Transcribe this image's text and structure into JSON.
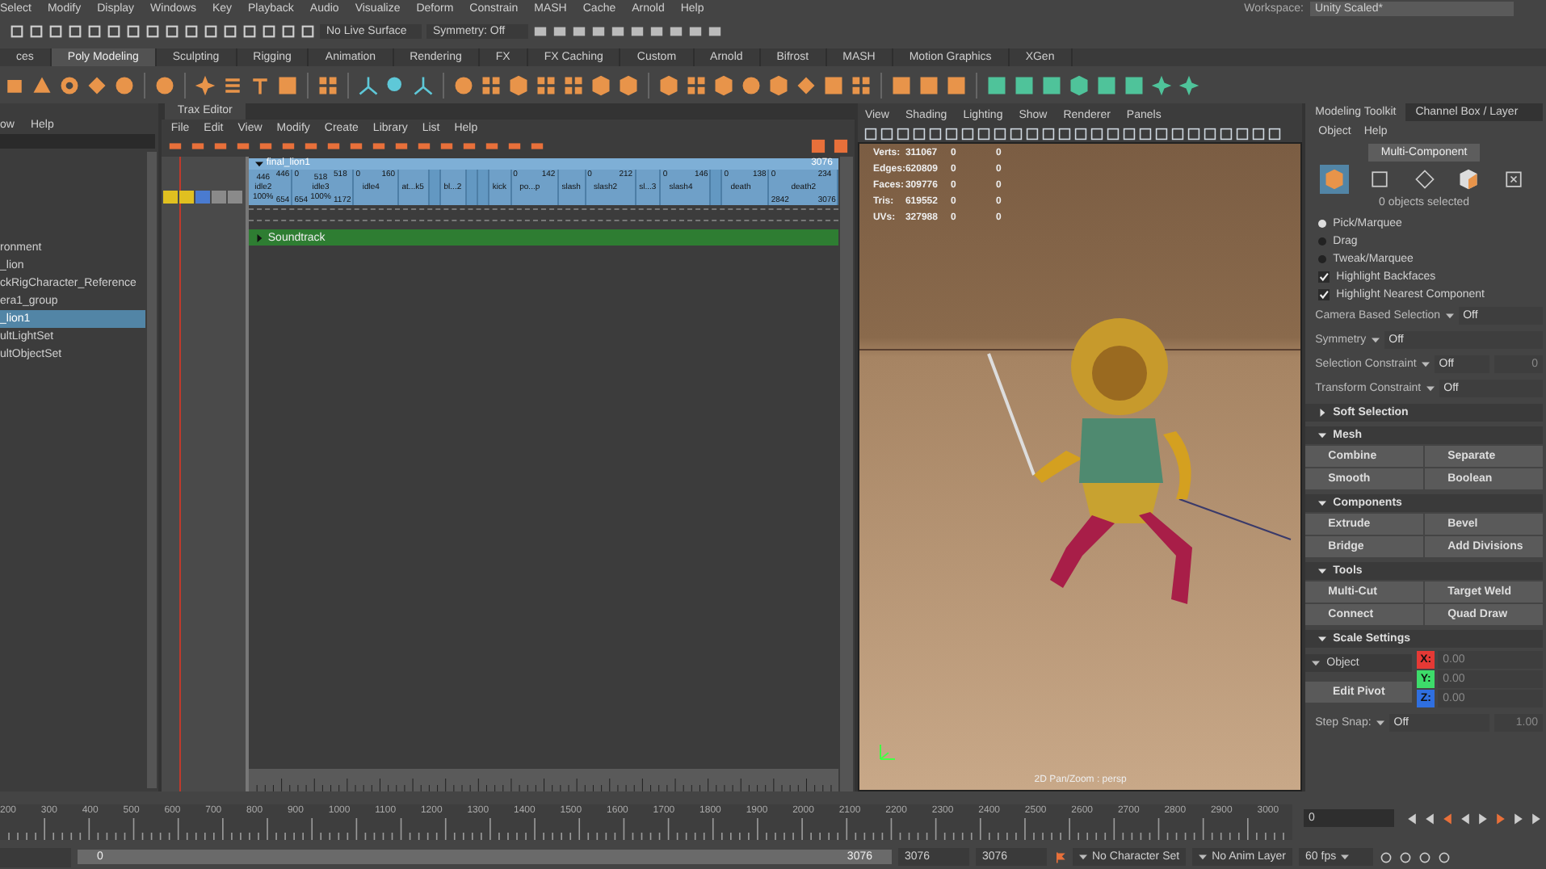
{
  "menu_bar": {
    "items": [
      "Select",
      "Modify",
      "Display",
      "Windows",
      "Key",
      "Playback",
      "Audio",
      "Visualize",
      "Deform",
      "Constrain",
      "MASH",
      "Cache",
      "Arnold",
      "Help"
    ],
    "workspace_label": "Workspace:",
    "workspace": "Unity Scaled*"
  },
  "status_line": {
    "live_surface": "No Live Surface",
    "symmetry": "Symmetry: Off"
  },
  "shelf": {
    "tabs": [
      {
        "label": "ces",
        "selected": false
      },
      {
        "label": "Poly Modeling",
        "selected": true
      },
      {
        "label": "Sculpting",
        "selected": false
      },
      {
        "label": "Rigging",
        "selected": false
      },
      {
        "label": "Animation",
        "selected": false
      },
      {
        "label": "Rendering",
        "selected": false
      },
      {
        "label": "FX",
        "selected": false
      },
      {
        "label": "FX Caching",
        "selected": false
      },
      {
        "label": "Custom",
        "selected": false
      },
      {
        "label": "Arnold",
        "selected": false
      },
      {
        "label": "Bifrost",
        "selected": false
      },
      {
        "label": "MASH",
        "selected": false
      },
      {
        "label": "Motion Graphics",
        "selected": false
      },
      {
        "label": "XGen",
        "selected": false
      }
    ]
  },
  "outliner": {
    "menu": [
      "ow",
      "Help"
    ],
    "items": [
      {
        "label": "ronment",
        "selected": false
      },
      {
        "label": "_lion",
        "selected": false
      },
      {
        "label": "ckRigCharacter_Reference",
        "selected": false
      },
      {
        "label": "era1_group",
        "selected": false
      },
      {
        "label": "_lion1",
        "selected": true
      },
      {
        "label": "ultLightSet",
        "selected": false
      },
      {
        "label": "ultObjectSet",
        "selected": false
      }
    ]
  },
  "trax_editor": {
    "title": "Trax Editor",
    "menu": [
      "File",
      "Edit",
      "View",
      "Modify",
      "Create",
      "Library",
      "List",
      "Help"
    ],
    "character": "final_lion1",
    "expanded": true,
    "end_frame": "3076",
    "clips": [
      {
        "center": [
          "446",
          "idle2",
          "100%"
        ],
        "tr": "446",
        "br": "654"
      },
      {
        "tl": "0",
        "center": [
          "518",
          "idle3",
          "100%"
        ],
        "tr": "518",
        "bl": "654",
        "br": "1172"
      },
      {
        "tl": "0",
        "tr": "160",
        "center": [
          "idle4"
        ]
      },
      {
        "center": [
          "at...k5"
        ]
      },
      {
        "kind": "blank"
      },
      {
        "center": [
          "bl...2"
        ]
      },
      {
        "kind": "blank"
      },
      {
        "kind": "blank"
      },
      {
        "center": [
          "kick"
        ]
      },
      {
        "tl": "0",
        "tr": "142",
        "center": [
          "po...p"
        ]
      },
      {
        "center": [
          "slash"
        ]
      },
      {
        "tl": "0",
        "tr": "212",
        "center": [
          "slash2"
        ]
      },
      {
        "center": [
          "sl...3"
        ]
      },
      {
        "tl": "0",
        "tr": "146",
        "center": [
          "slash4"
        ]
      },
      {
        "kind": "blank"
      },
      {
        "tl": "0",
        "tr": "138",
        "center": [
          "death"
        ]
      },
      {
        "tl": "0",
        "tr": "234",
        "center": [
          "death2"
        ],
        "bl": "2842",
        "br": "3076"
      }
    ],
    "soundtrack": "Soundtrack",
    "soundtrack_expanded": false
  },
  "viewport": {
    "menu": [
      "View",
      "Shading",
      "Lighting",
      "Show",
      "Renderer",
      "Panels"
    ],
    "stats": [
      {
        "label": "Verts:",
        "values": [
          "311067",
          "0",
          "0"
        ]
      },
      {
        "label": "Edges:",
        "values": [
          "620809",
          "0",
          "0"
        ]
      },
      {
        "label": "Faces:",
        "values": [
          "309776",
          "0",
          "0"
        ]
      },
      {
        "label": "Tris:",
        "values": [
          "619552",
          "0",
          "0"
        ]
      },
      {
        "label": "UVs:",
        "values": [
          "327988",
          "0",
          "0"
        ]
      }
    ],
    "camera_label": "2D Pan/Zoom : persp"
  },
  "modeling_toolkit": {
    "tabs": [
      {
        "label": "Modeling Toolkit",
        "selected": true
      },
      {
        "label": "Channel Box / Layer",
        "selected": false
      }
    ],
    "menu": [
      "Object",
      "Help"
    ],
    "mode_button": "Multi-Component",
    "modes": [
      {
        "kind": "object",
        "selected": true
      },
      {
        "kind": "vertex",
        "selected": false
      },
      {
        "kind": "edge",
        "selected": false
      },
      {
        "kind": "face",
        "selected": false
      },
      {
        "kind": "uv",
        "selected": false
      }
    ],
    "selection_count": "0 objects selected",
    "pick_modes": [
      {
        "label": "Pick/Marquee",
        "selected": true
      },
      {
        "label": "Drag",
        "selected": false
      },
      {
        "label": "Tweak/Marquee",
        "selected": false
      }
    ],
    "options": [
      {
        "label": "Highlight Backfaces",
        "checked": true
      },
      {
        "label": "Highlight Nearest Component",
        "checked": true
      }
    ],
    "settings": [
      {
        "label": "Camera Based Selection",
        "value": "Off"
      },
      {
        "label": "Symmetry",
        "value": "Off"
      },
      {
        "label": "Selection Constraint",
        "value": "Off",
        "extra": "0"
      },
      {
        "label": "Transform Constraint",
        "value": "Off"
      }
    ],
    "sections": [
      {
        "title": "Soft Selection",
        "expanded": false
      },
      {
        "title": "Mesh",
        "expanded": true,
        "buttons": [
          "Combine",
          "Separate",
          "Smooth",
          "Boolean"
        ]
      },
      {
        "title": "Components",
        "expanded": true,
        "buttons": [
          "Extrude",
          "Bevel",
          "Bridge",
          "Add Divisions"
        ]
      },
      {
        "title": "Tools",
        "expanded": true,
        "buttons": [
          "Multi-Cut",
          "Target Weld",
          "Connect",
          "Quad Draw"
        ]
      }
    ],
    "scale_settings": {
      "title": "Scale Settings",
      "expanded": true,
      "space": "Object",
      "axes": [
        {
          "label": "X:",
          "value": "0.00",
          "disabled": true,
          "color": "#e53935"
        },
        {
          "label": "Y:",
          "value": "0.00",
          "disabled": true,
          "color": "#3ddc6a"
        },
        {
          "label": "Z:",
          "value": "0.00",
          "disabled": true,
          "color": "#2f6fe0"
        }
      ],
      "pivot_button": "Edit Pivot",
      "step_label": "Step Snap:",
      "step_value": "Off",
      "step_amount": "1.00"
    }
  },
  "time_slider": {
    "ticks": [
      "200",
      "300",
      "400",
      "500",
      "600",
      "700",
      "800",
      "900",
      "1000",
      "1100",
      "1200",
      "1300",
      "1400",
      "1500",
      "1600",
      "1700",
      "1800",
      "1900",
      "2000",
      "2100",
      "2200",
      "2300",
      "2400",
      "2500",
      "2600",
      "2700",
      "2800",
      "2900",
      "3000"
    ],
    "current_frame": "0"
  },
  "range_slider": {
    "bar_start": "0",
    "bar_end": "3076",
    "start_field": "3076",
    "end_field": "3076",
    "character_set": "No Character Set",
    "anim_layer": "No Anim Layer",
    "fps": "60 fps"
  }
}
